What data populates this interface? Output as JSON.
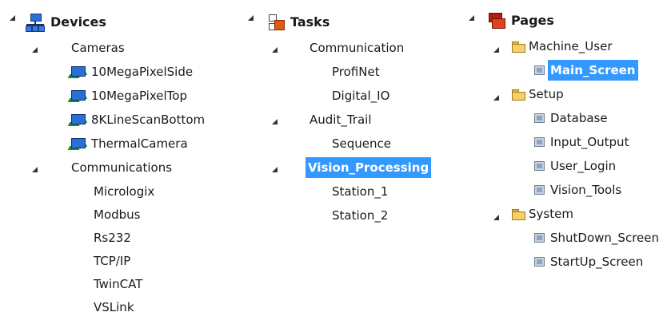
{
  "devices": {
    "title": "Devices",
    "cameras_label": "Cameras",
    "cameras": [
      "10MegaPixelSide",
      "10MegaPixelTop",
      "8KLineScanBottom",
      "ThermalCamera"
    ],
    "communications_label": "Communications",
    "communications": [
      "Micrologix",
      "Modbus",
      "Rs232",
      "TCP/IP",
      "TwinCAT",
      "VSLink"
    ]
  },
  "tasks": {
    "title": "Tasks",
    "communication_label": "Communication",
    "communication": [
      "ProfiNet",
      "Digital_IO"
    ],
    "audit_label": "Audit_Trail",
    "audit": [
      "Sequence"
    ],
    "vision_label": "Vision_Processing",
    "vision": [
      "Station_1",
      "Station_2"
    ]
  },
  "pages": {
    "title": "Pages",
    "machine_user_label": "Machine_User",
    "machine_user": [
      "Main_Screen"
    ],
    "setup_label": "Setup",
    "setup": [
      "Database",
      "Input_Output",
      "User_Login",
      "Vision_Tools"
    ],
    "system_label": "System",
    "system": [
      "ShutDown_Screen",
      "StartUp_Screen"
    ]
  },
  "colors": {
    "selection": "#3399ff",
    "selection_text": "#ffffff"
  }
}
